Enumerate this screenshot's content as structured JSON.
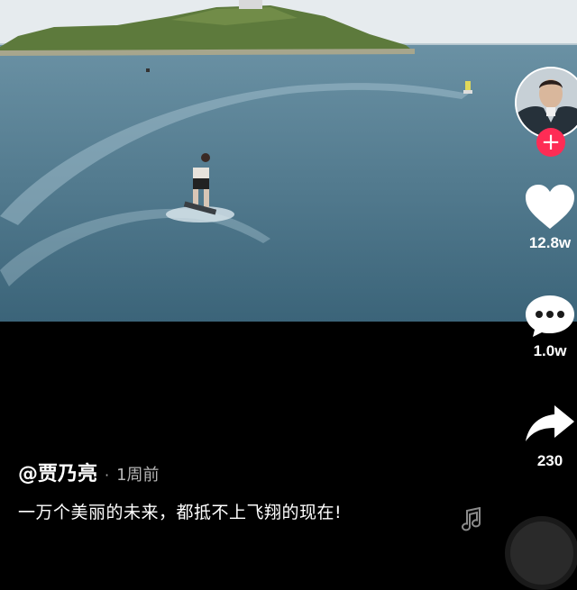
{
  "video": {
    "description_icons": [
      "island",
      "jetboard-rider"
    ]
  },
  "creator": {
    "handle": "@贾乃亮",
    "posted": "1周前"
  },
  "caption": {
    "text": "一万个美丽的未来，都抵不上飞翔的现在!"
  },
  "actions": {
    "like_count": "12.8w",
    "comment_count": "1.0w",
    "share_count": "230"
  },
  "colors": {
    "follow": "#fe2c55",
    "icon": "#ffffff",
    "background": "#000000"
  }
}
